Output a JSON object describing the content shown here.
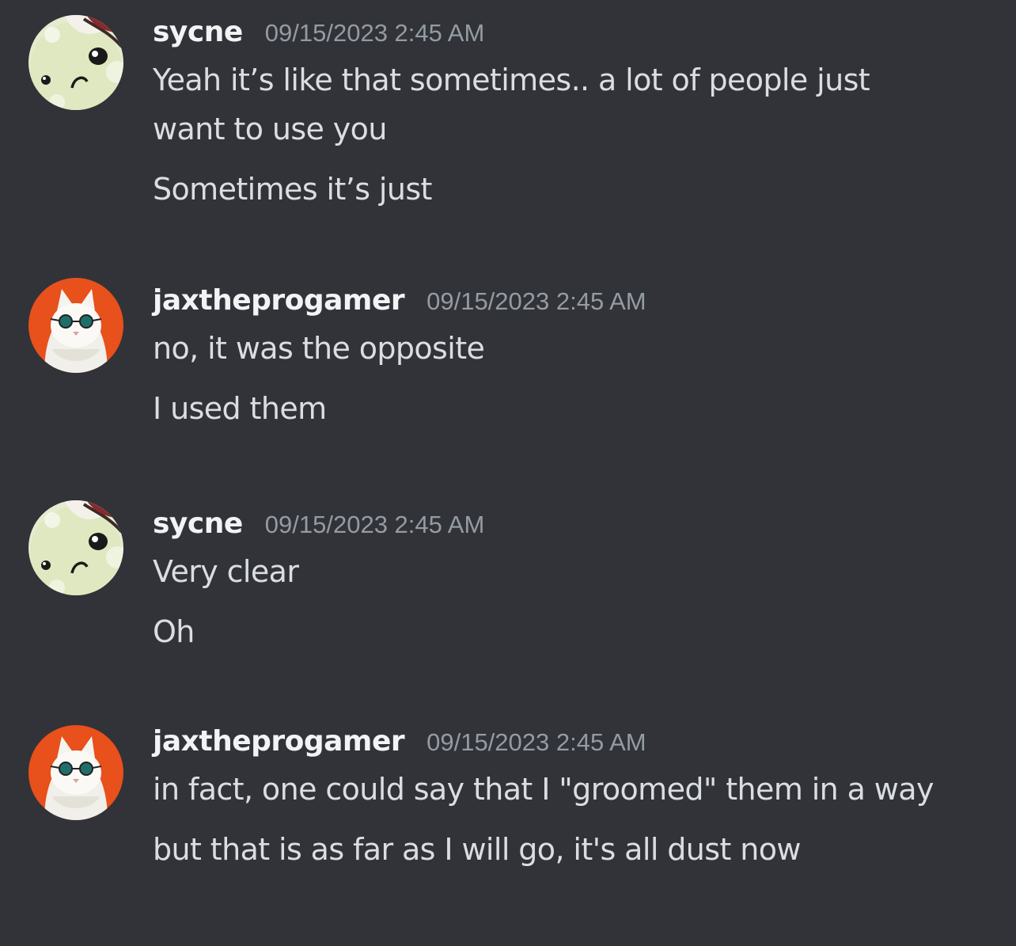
{
  "colors": {
    "background": "#313338",
    "username": "#f2f3f5",
    "timestamp": "#949ba4",
    "message": "#dbdee1"
  },
  "messages": [
    {
      "username": "sycne",
      "timestamp": "09/15/2023 2:45 AM",
      "avatar_icon": "cartoon-face-avatar",
      "lines": [
        "Yeah it’s like that sometimes.. a lot of people just want to use you",
        "Sometimes it’s just"
      ]
    },
    {
      "username": "jaxtheprogamer",
      "timestamp": "09/15/2023 2:45 AM",
      "avatar_icon": "cat-with-sunglasses-avatar",
      "lines": [
        "no, it was the opposite",
        "I used them"
      ]
    },
    {
      "username": "sycne",
      "timestamp": "09/15/2023 2:45 AM",
      "avatar_icon": "cartoon-face-avatar",
      "lines": [
        "Very clear",
        "Oh"
      ]
    },
    {
      "username": "jaxtheprogamer",
      "timestamp": "09/15/2023 2:45 AM",
      "avatar_icon": "cat-with-sunglasses-avatar",
      "lines": [
        "in fact, one could say that I \"groomed\" them in a way",
        "but that is as far as I will go, it's all dust now"
      ]
    }
  ]
}
